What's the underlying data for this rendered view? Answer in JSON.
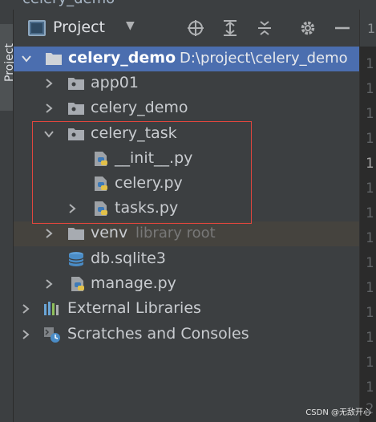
{
  "window": {
    "title_partial": "celery_demo",
    "tool_window_tab": "Project"
  },
  "header": {
    "title": "Project"
  },
  "toolbar": [
    "locate-icon",
    "expand-all-icon",
    "collapse-all-icon",
    "settings-gear-icon",
    "hide-minus-icon"
  ],
  "tree": {
    "root": {
      "name": "celery_demo",
      "path": "D:\\project\\celery_demo"
    },
    "app01": "app01",
    "celery_demo_pkg": "celery_demo",
    "celery_task": "celery_task",
    "init_py": "__init__.py",
    "celery_py": "celery.py",
    "tasks_py": "tasks.py",
    "venv": {
      "name": "venv",
      "note": "library root"
    },
    "db": "db.sqlite3",
    "manage": "manage.py",
    "ext_libs": "External Libraries",
    "scratches": "Scratches and Consoles"
  },
  "gutter": {
    "top": "1",
    "lines": [
      "1",
      "1",
      "1",
      "1",
      "1",
      "1",
      "1",
      "1",
      "1",
      "1",
      "1",
      "1",
      "1",
      "1",
      "2"
    ]
  },
  "colors": {
    "selection": "#4b6eaf",
    "highlight_box": "#e0463e",
    "library_row": "#45433e"
  },
  "watermark": "CSDN @无敌开心"
}
